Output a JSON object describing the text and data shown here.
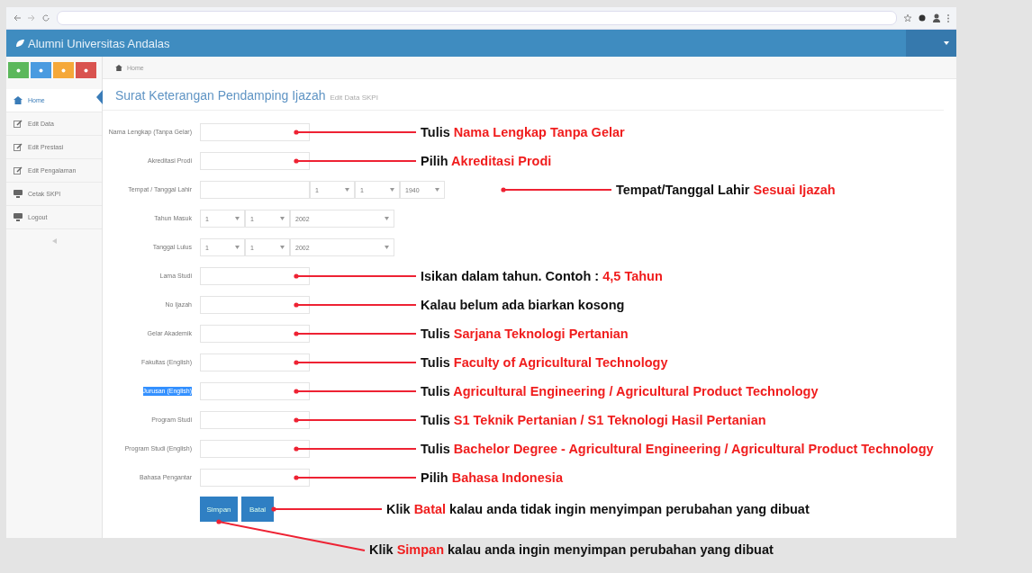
{
  "app": {
    "title": "Alumni Universitas Andalas"
  },
  "breadcrumb": "Home",
  "sidebar": {
    "items": [
      {
        "label": "Home",
        "selected": true
      },
      {
        "label": "Edit Data",
        "selected": false
      },
      {
        "label": "Edit Prestasi",
        "selected": false
      },
      {
        "label": "Edit Pengalaman",
        "selected": false
      },
      {
        "label": "Cetak SKPI",
        "selected": false
      },
      {
        "label": "Logout",
        "selected": false
      }
    ]
  },
  "page": {
    "title": "Surat Keterangan Pendamping Ijazah",
    "subtitle": "Edit Data SKPI"
  },
  "fields": [
    {
      "label": "Nama Lengkap (Tanpa Gelar)",
      "kind": "text",
      "highlighted": false,
      "annotation": "Tulis *Nama Lengkap Tanpa Gelar*"
    },
    {
      "label": "Akreditasi Prodi",
      "kind": "text",
      "highlighted": false,
      "annotation": "Pilih *Akreditasi Prodi*"
    },
    {
      "label": "Tempat / Tanggal Lahir",
      "kind": "birth",
      "highlighted": false,
      "selects": [
        "1",
        "1",
        "1940"
      ],
      "annotation": "Tempat/Tanggal Lahir *Sesuai Ijazah*"
    },
    {
      "label": "Tahun Masuk",
      "kind": "date",
      "highlighted": false,
      "selects": [
        "1",
        "1",
        "2002"
      ]
    },
    {
      "label": "Tanggal Lulus",
      "kind": "date",
      "highlighted": false,
      "selects": [
        "1",
        "1",
        "2002"
      ]
    },
    {
      "label": "Lama Studi",
      "kind": "text",
      "highlighted": false,
      "annotation": "Isikan dalam tahun. Contoh : *4,5 Tahun*"
    },
    {
      "label": "No Ijazah",
      "kind": "text",
      "highlighted": false,
      "annotation": "Kalau belum ada biarkan kosong"
    },
    {
      "label": "Gelar Akademik",
      "kind": "text",
      "highlighted": false,
      "annotation": "Tulis *Sarjana Teknologi Pertanian*"
    },
    {
      "label": "Fakultas (English)",
      "kind": "text",
      "highlighted": false,
      "annotation": "Tulis *Faculty of Agricultural Technology*"
    },
    {
      "label": "Jurusan (English)",
      "kind": "text",
      "highlighted": true,
      "annotation": "Tulis *Agricultural Engineering / Agricultural Product Technology*"
    },
    {
      "label": "Program Studi",
      "kind": "text",
      "highlighted": false,
      "annotation": "Tulis *S1 Teknik Pertanian / S1 Teknologi Hasil Pertanian*"
    },
    {
      "label": "Program Studi (English)",
      "kind": "text",
      "highlighted": false,
      "annotation": "Tulis *Bachelor Degree - Agricultural Engineering / Agricultural Product Technology*"
    },
    {
      "label": "Bahasa Pengantar",
      "kind": "text",
      "highlighted": false,
      "annotation": "Pilih *Bahasa Indonesia*"
    }
  ],
  "buttons": [
    {
      "label": "Simpan"
    },
    {
      "label": "Batal"
    }
  ],
  "notes": [
    {
      "kind": "cancel",
      "text": "Klik *Batal* kalau anda tidak ingin menyimpan perubahan yang dibuat"
    },
    {
      "kind": "save",
      "text": "Klik *Simpan* kalau anda ingin menyimpan perubahan yang dibuat"
    }
  ]
}
